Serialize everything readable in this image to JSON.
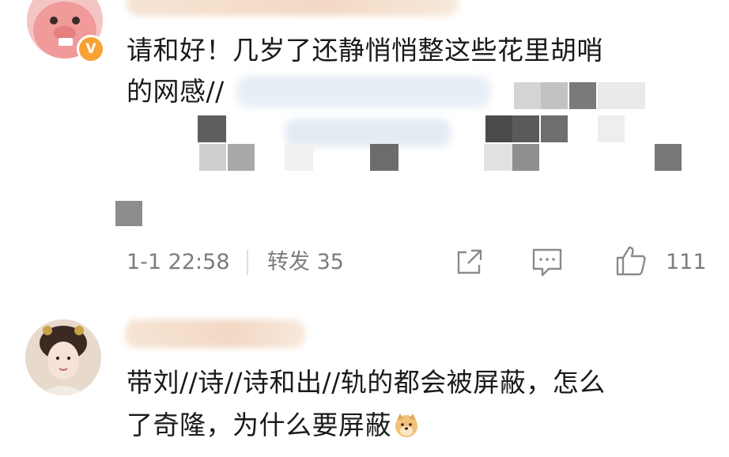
{
  "comments": [
    {
      "text_lines": [
        "请和好！几岁了还静悄悄整这些花里胡哨",
        "的网感//"
      ],
      "verified_badge": "V",
      "timestamp": "1-1 22:58",
      "repost_label": "转发 35",
      "like_count": "111",
      "icons": [
        "repost-icon",
        "comment-icon",
        "like-icon"
      ]
    },
    {
      "text_lines": [
        "带刘//诗//诗和出//轨的都会被屏蔽，怎么",
        "了奇隆，为什么要屏蔽"
      ],
      "emoji": "doge-emoji"
    }
  ],
  "colors": {
    "text": "#1a1a1a",
    "meta": "#7c7c7c",
    "badge": "#f7a233",
    "icon": "#8a8a8a"
  }
}
